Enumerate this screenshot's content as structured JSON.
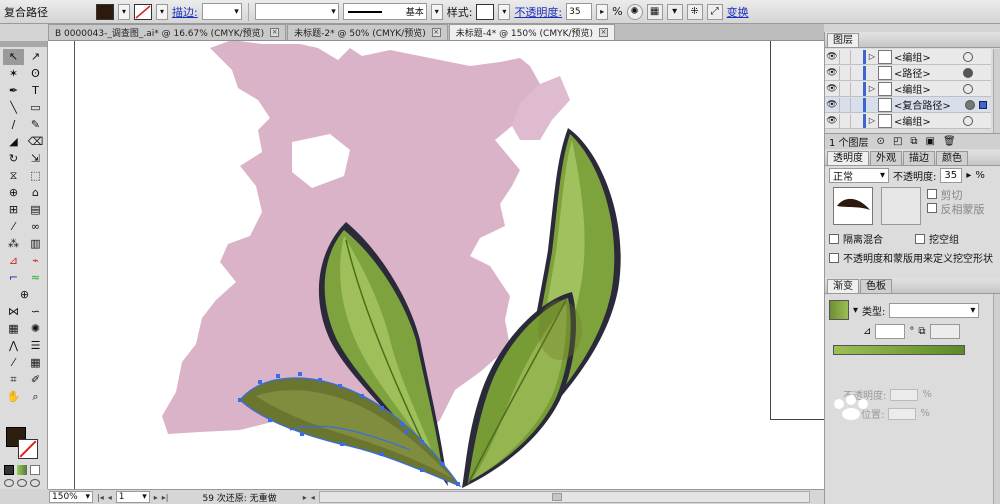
{
  "control_bar": {
    "object_type": "复合路径",
    "stroke_label": "描边:",
    "brush_label": "基本",
    "style_label": "样式:",
    "opacity_label": "不透明度:",
    "opacity_value": "35",
    "opacity_unit": "%",
    "transform_label": "变换",
    "fill_color": "#2d1a0c"
  },
  "tabs": [
    {
      "label": "B 0000043-_调查图_.ai* @ 16.67% (CMYK/预览)",
      "active": false
    },
    {
      "label": "未标题-2* @ 50% (CMYK/预览)",
      "active": false
    },
    {
      "label": "未标题-4* @ 150% (CMYK/预览)",
      "active": true
    }
  ],
  "status": {
    "zoom": "150%",
    "page": "1",
    "info": "59 次还原: 无重做"
  },
  "layers_panel": {
    "title": "图层",
    "rows": [
      {
        "label": "<编组>",
        "expand": true
      },
      {
        "label": "<路径>",
        "expand": false
      },
      {
        "label": "<编组>",
        "expand": true
      },
      {
        "label": "<复合路径>",
        "expand": false
      },
      {
        "label": "<编组>",
        "expand": true
      },
      {
        "label": "<编组>",
        "expand": true
      }
    ],
    "footer": "1 个图层"
  },
  "transparency_panel": {
    "tabs": [
      "透明度",
      "外观",
      "描边",
      "颜色"
    ],
    "blend_mode": "正常",
    "opacity_label": "不透明度:",
    "opacity_value": "35",
    "opacity_unit": "%",
    "clip_label": "剪切",
    "invert_mask_label": "反相蒙版",
    "isolate_label": "隔离混合",
    "knockout_label": "挖空组",
    "opacity_mask_label": "不透明度和蒙版用来定义挖空形状"
  },
  "gradient_panel": {
    "tabs": [
      "渐变",
      "色板"
    ],
    "type_label": "类型:",
    "opacity_label": "不透明度:",
    "position_label": "位置:",
    "percent": "%"
  },
  "colors": {
    "fill": "#2d1f10",
    "silhouette": "#dbb3c9",
    "leaf_dark": "#55772a",
    "leaf_light": "#9ec05a",
    "selection": "#3a6ee0"
  }
}
